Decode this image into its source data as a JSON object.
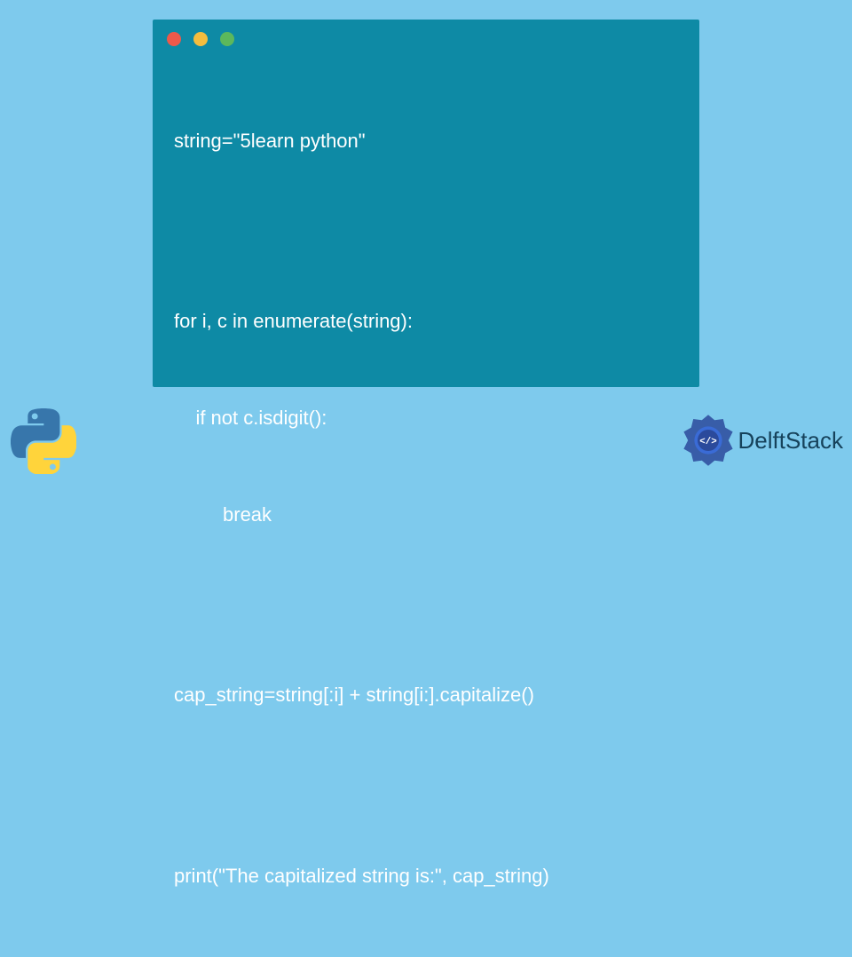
{
  "window": {
    "dots": [
      "red",
      "yellow",
      "green"
    ]
  },
  "code": {
    "lines": [
      "string=\"5learn python\"",
      "",
      "for i, c in enumerate(string):",
      "    if not c.isdigit():",
      "         break",
      "",
      "cap_string=string[:i] + string[i:].capitalize()",
      "",
      "print(\"The capitalized string is:\", cap_string)"
    ]
  },
  "branding": {
    "name": "DelftStack"
  },
  "colors": {
    "background": "#7ecaed",
    "window": "#0e8aa5",
    "text": "#ffffff",
    "brand": "#16425b"
  }
}
